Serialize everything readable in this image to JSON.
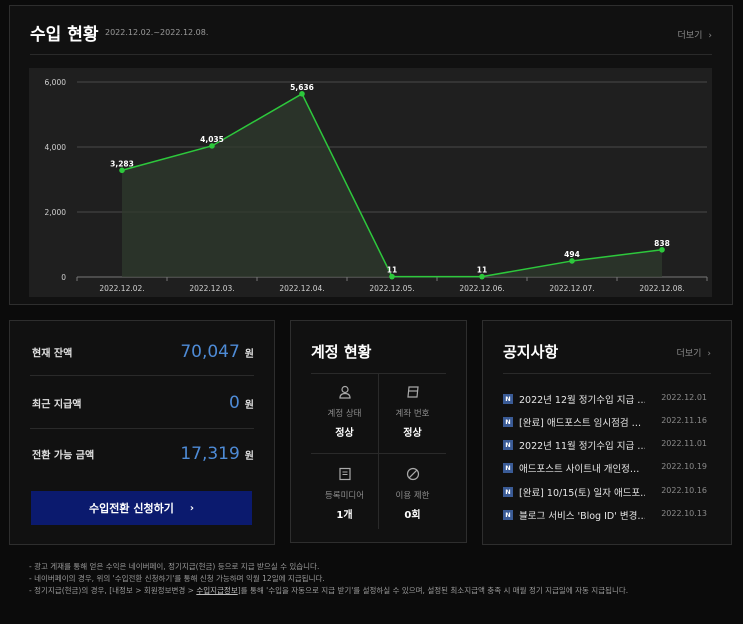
{
  "revenue": {
    "title": "수입 현황",
    "range": "2022.12.02.~2022.12.08.",
    "more": "더보기"
  },
  "chart_data": {
    "type": "area",
    "categories": [
      "2022.12.02.",
      "2022.12.03.",
      "2022.12.04.",
      "2022.12.05.",
      "2022.12.06.",
      "2022.12.07.",
      "2022.12.08."
    ],
    "values": [
      3283,
      4035,
      5636,
      11,
      11,
      494,
      838
    ],
    "value_labels": [
      "3,283",
      "4,035",
      "5,636",
      "11",
      "11",
      "494",
      "838"
    ],
    "ylim": [
      0,
      6000
    ],
    "yticks": [
      0,
      2000,
      4000,
      6000
    ],
    "ytick_labels": [
      "0",
      "2,000",
      "4,000",
      "6,000"
    ],
    "grid": true,
    "line_color": "#2dc83c",
    "title": "",
    "xlabel": "",
    "ylabel": ""
  },
  "balance": {
    "rows": [
      {
        "label": "현재 잔액",
        "value": "70,047",
        "unit": "원"
      },
      {
        "label": "최근 지급액",
        "value": "0",
        "unit": "원"
      },
      {
        "label": "전환 가능 금액",
        "value": "17,319",
        "unit": "원"
      }
    ],
    "button": "수입전환 신청하기"
  },
  "account": {
    "title": "계정 현황",
    "cells": [
      {
        "icon": "person-icon",
        "label": "계정 상태",
        "value": "정상"
      },
      {
        "icon": "bank-card-icon",
        "label": "계좌 번호",
        "value": "정상"
      },
      {
        "icon": "document-icon",
        "label": "등록미디어",
        "value": "1개"
      },
      {
        "icon": "prohibited-icon",
        "label": "이용 제한",
        "value": "0회"
      }
    ]
  },
  "notice": {
    "title": "공지사항",
    "more": "더보기",
    "badge": "N",
    "items": [
      {
        "text": "2022년 12월 정기수입 지급 …",
        "date": "2022.12.01"
      },
      {
        "text": "[완료] 애드포스트 임시점검 …",
        "date": "2022.11.16"
      },
      {
        "text": "2022년 11월 정기수입 지급 …",
        "date": "2022.11.01"
      },
      {
        "text": "애드포스트 사이트내 개인정…",
        "date": "2022.10.19"
      },
      {
        "text": "[완료] 10/15(토) 일자 애드포…",
        "date": "2022.10.16"
      },
      {
        "text": "블로그 서비스 'Blog ID' 변경…",
        "date": "2022.10.13"
      }
    ]
  },
  "notes": {
    "line1": "- 광고 게재를 통해 얻은 수익은 네이버페이, 정기지급(현금) 등으로 지급 받으실 수 있습니다.",
    "line2": "- 네이버페이의 경우, 위의 '수입전환 신청하기'를 통해 신청 가능하며 익월 12일에 지급됩니다.",
    "line3_a": "- 정기지급(현금)의 경우, [내정보 > 회원정보변경 > ",
    "line3_link": "수입지급정보",
    "line3_b": "]를 통해 '수입을 자동으로 지급 받기'를 설정하실 수 있으며, 설정된 최소지급액 충족 시 매월 정기 지급일에 자동 지급됩니다."
  }
}
